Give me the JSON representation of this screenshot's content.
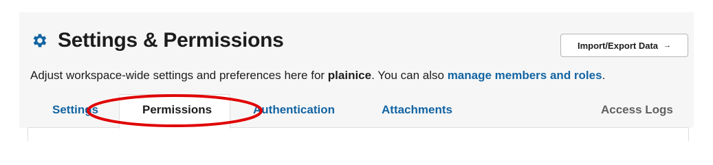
{
  "header": {
    "title": "Settings & Permissions",
    "icon": "gear-icon",
    "accent_color": "#1264a3"
  },
  "import_button": {
    "label": "Import/Export Data",
    "arrow": "→"
  },
  "description": {
    "prefix": "Adjust workspace-wide settings and preferences here for ",
    "workspace": "plainice",
    "middle": ". You can also ",
    "link": "manage members and roles",
    "suffix": "."
  },
  "tabs": [
    {
      "label": "Settings",
      "active": false
    },
    {
      "label": "Permissions",
      "active": true
    },
    {
      "label": "Authentication",
      "active": false
    },
    {
      "label": "Attachments",
      "active": false
    },
    {
      "label": "Access Logs",
      "active": false
    }
  ],
  "annotation": {
    "shape": "ellipse",
    "color": "#e00000",
    "target": "Permissions"
  }
}
